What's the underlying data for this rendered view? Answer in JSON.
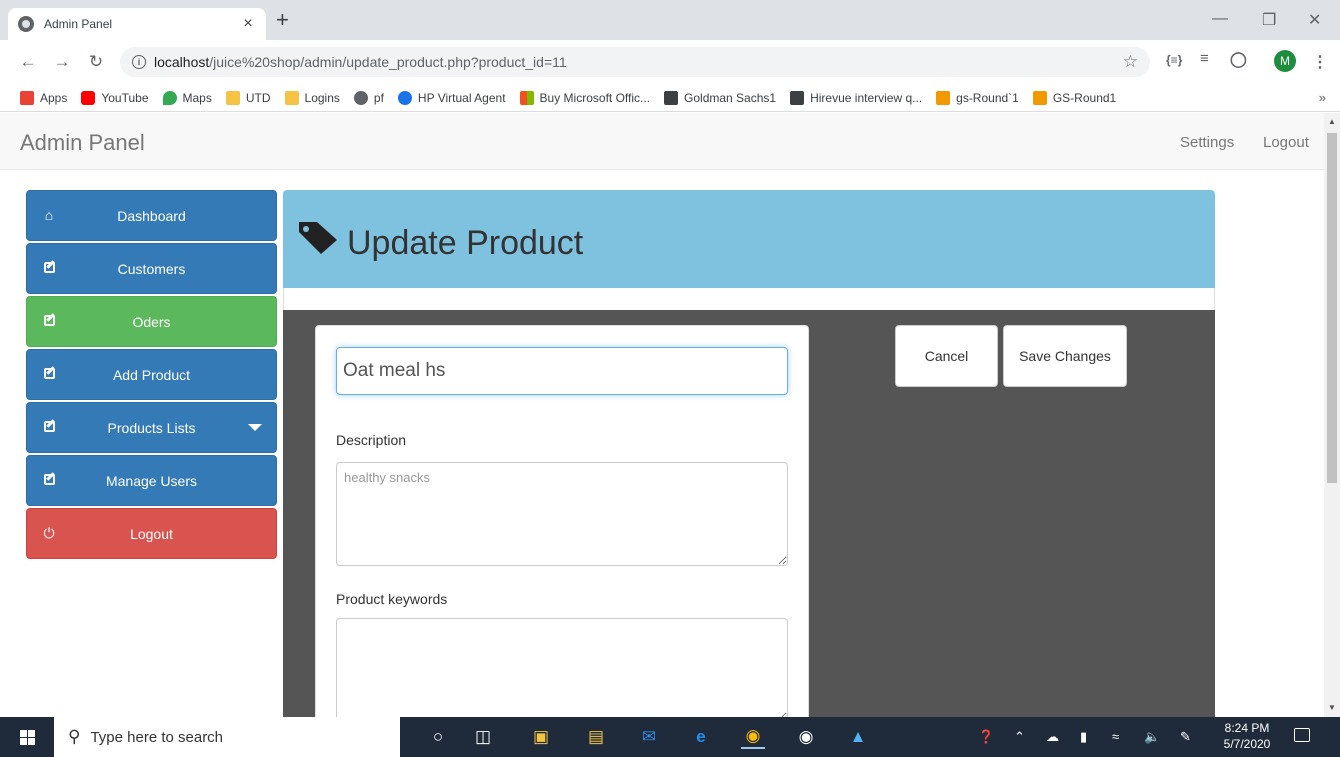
{
  "browser": {
    "tab_title": "Admin Panel",
    "tab_close": "×",
    "new_tab": "+",
    "url_host": "localhost",
    "url_path": "/juice%20shop/admin/update_product.php?product_id=11",
    "profile_initial": "M",
    "bookmarks": [
      "Apps",
      "YouTube",
      "Maps",
      "UTD",
      "Logins",
      "pf",
      "HP Virtual Agent",
      "Buy Microsoft Offic...",
      "Goldman Sachs1",
      "Hirevue interview q...",
      "gs-Round`1",
      "GS-Round1"
    ],
    "bookmarks_more": "»",
    "ext_label": "{≡}"
  },
  "app": {
    "brand": "Admin Panel",
    "nav": {
      "settings": "Settings",
      "logout": "Logout"
    }
  },
  "sidebar": {
    "items": [
      {
        "label": "Dashboard",
        "icon": "home-icon",
        "color": "#337ab7"
      },
      {
        "label": "Customers",
        "icon": "edit-icon",
        "color": "#337ab7"
      },
      {
        "label": "Oders",
        "icon": "edit-icon",
        "color": "#5cb85c"
      },
      {
        "label": "Add Product",
        "icon": "edit-icon",
        "color": "#337ab7"
      },
      {
        "label": "Products Lists",
        "icon": "edit-icon",
        "color": "#337ab7"
      },
      {
        "label": "Manage Users",
        "icon": "edit-icon",
        "color": "#337ab7"
      },
      {
        "label": "Logout",
        "icon": "power-icon",
        "color": "#d9534f"
      }
    ]
  },
  "main": {
    "title": "Update Product",
    "name_value": "Oat meal hs",
    "description_label": "Description",
    "description_placeholder": "healthy snacks",
    "keywords_label": "Product keywords",
    "cancel": "Cancel",
    "save": "Save Changes"
  },
  "taskbar": {
    "search_placeholder": "Type here to search",
    "time": "8:24 PM",
    "date": "5/7/2020"
  },
  "colors": {
    "header_bg": "#7fc2e0",
    "body_bg": "#555555",
    "primary": "#337ab7",
    "success": "#5cb85c",
    "danger": "#d9534f"
  }
}
